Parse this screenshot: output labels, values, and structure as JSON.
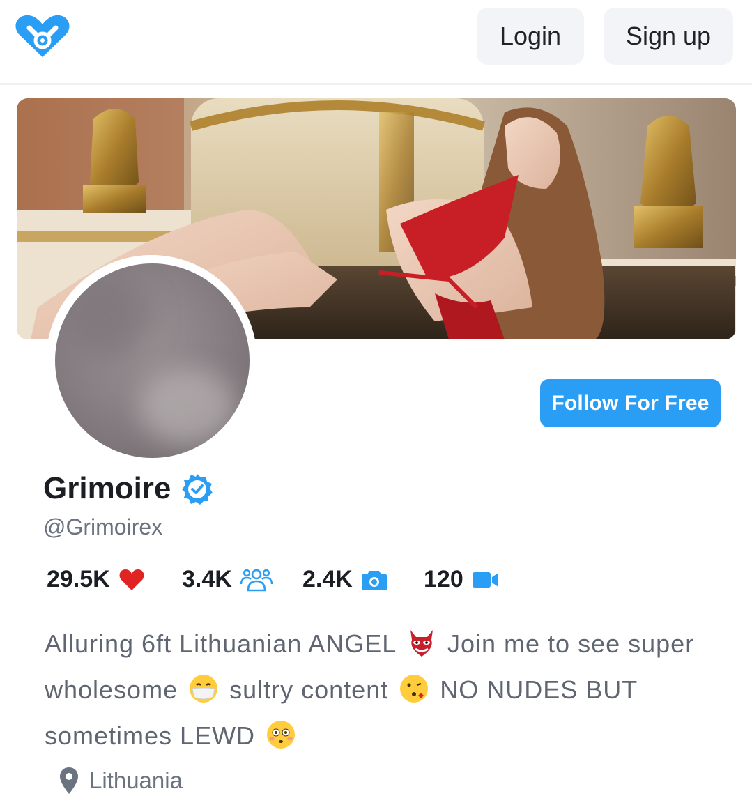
{
  "header": {
    "logo_icon": "heart-lock-logo-icon",
    "login_label": "Login",
    "signup_label": "Sign up"
  },
  "profile": {
    "name": "Grimoire",
    "verified_icon": "verified-badge-icon",
    "handle": "@Grimoirex",
    "follow_label": "Follow For Free",
    "stats": {
      "likes": "29.5K",
      "fans": "3.4K",
      "photos": "2.4K",
      "videos": "120"
    },
    "bio": {
      "part1": "Alluring 6ft Lithuanian ANGEL",
      "part2": "Join me to see super wholesome",
      "part3": "sultry content",
      "part4": "NO NUDES BUT sometimes LEWD"
    },
    "location": "Lithuania"
  },
  "colors": {
    "brand_blue": "#2a9df4",
    "heart_red": "#e02424",
    "text_dark": "#1b1f24",
    "text_muted": "#6b7280"
  }
}
